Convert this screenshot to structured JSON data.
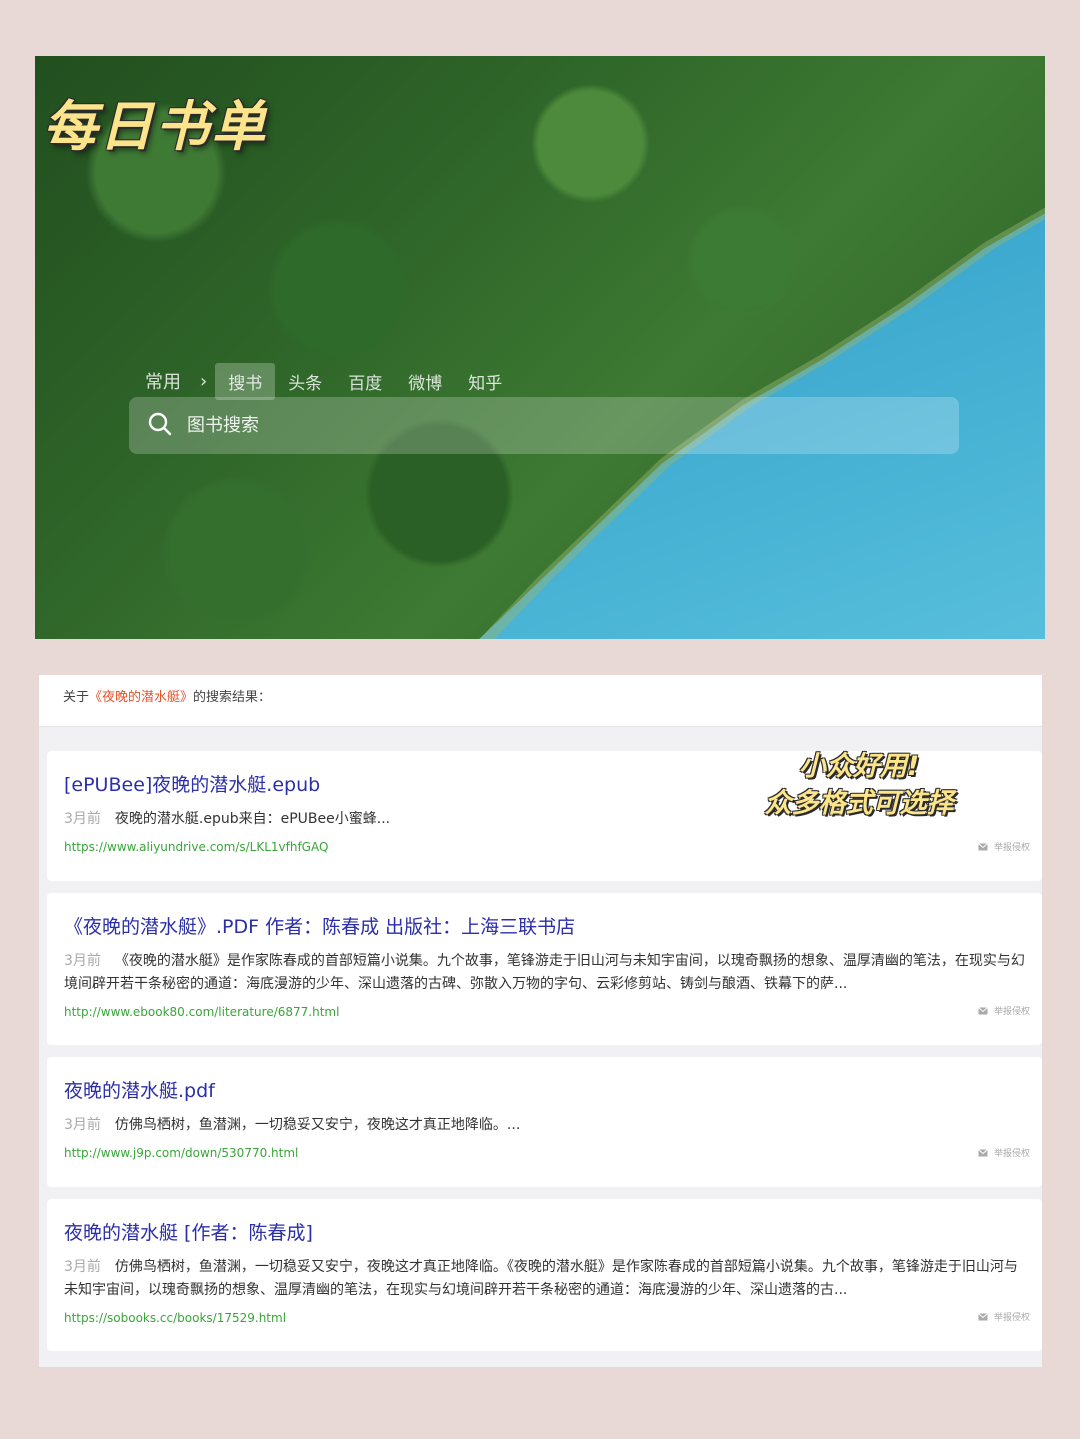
{
  "hero": {
    "title": "每日书单",
    "tabs": [
      {
        "label": "常用"
      },
      {
        "label": "搜书",
        "active": true
      },
      {
        "label": "头条"
      },
      {
        "label": "百度"
      },
      {
        "label": "微博"
      },
      {
        "label": "知乎"
      }
    ],
    "search_placeholder": "图书搜索"
  },
  "results": {
    "summary_prefix": "关于",
    "keyword": "《夜晚的潜水艇》",
    "summary_suffix": "的搜索结果：",
    "report_label": "举报侵权",
    "items": [
      {
        "title": "[ePUBee]夜晚的潜水艇.epub",
        "time": "3月前",
        "desc": "夜晚的潜水艇.epub来自：ePUBee小蜜蜂...",
        "url": "https://www.aliyundrive.com/s/LKL1vfhfGAQ"
      },
      {
        "title": "《夜晚的潜水艇》.PDF 作者：陈春成 出版社：上海三联书店",
        "time": "3月前",
        "desc": "《夜晚的潜水艇》是作家陈春成的首部短篇小说集。九个故事，笔锋游走于旧山河与未知宇宙间，以瑰奇飘扬的想象、温厚清幽的笔法，在现实与幻境间辟开若干条秘密的通道：海底漫游的少年、深山遗落的古碑、弥散入万物的字句、云彩修剪站、铸剑与酿酒、铁幕下的萨...",
        "url": "http://www.ebook80.com/literature/6877.html"
      },
      {
        "title": "夜晚的潜水艇.pdf",
        "time": "3月前",
        "desc": "仿佛鸟栖树，鱼潜渊，一切稳妥又安宁，夜晚这才真正地降临。...",
        "url": "http://www.j9p.com/down/530770.html"
      },
      {
        "title": "夜晚的潜水艇 [作者：陈春成]",
        "time": "3月前",
        "desc": "仿佛鸟栖树，鱼潜渊，一切稳妥又安宁，夜晚这才真正地降临。《夜晚的潜水艇》是作家陈春成的首部短篇小说集。九个故事，笔锋游走于旧山河与未知宇宙间，以瑰奇飘扬的想象、温厚清幽的笔法，在现实与幻境间辟开若干条秘密的通道：海底漫游的少年、深山遗落的古...",
        "url": "https://sobooks.cc/books/17529.html"
      }
    ]
  },
  "overlay_note": {
    "line1": "小众好用!",
    "line2": "众多格式可选择"
  },
  "colors": {
    "background": "#e9d9d6",
    "title_link": "#2b2fa8",
    "url_green": "#3aa53a",
    "keyword_red": "#e4532b",
    "overlay_yellow": "#fbe48a"
  }
}
